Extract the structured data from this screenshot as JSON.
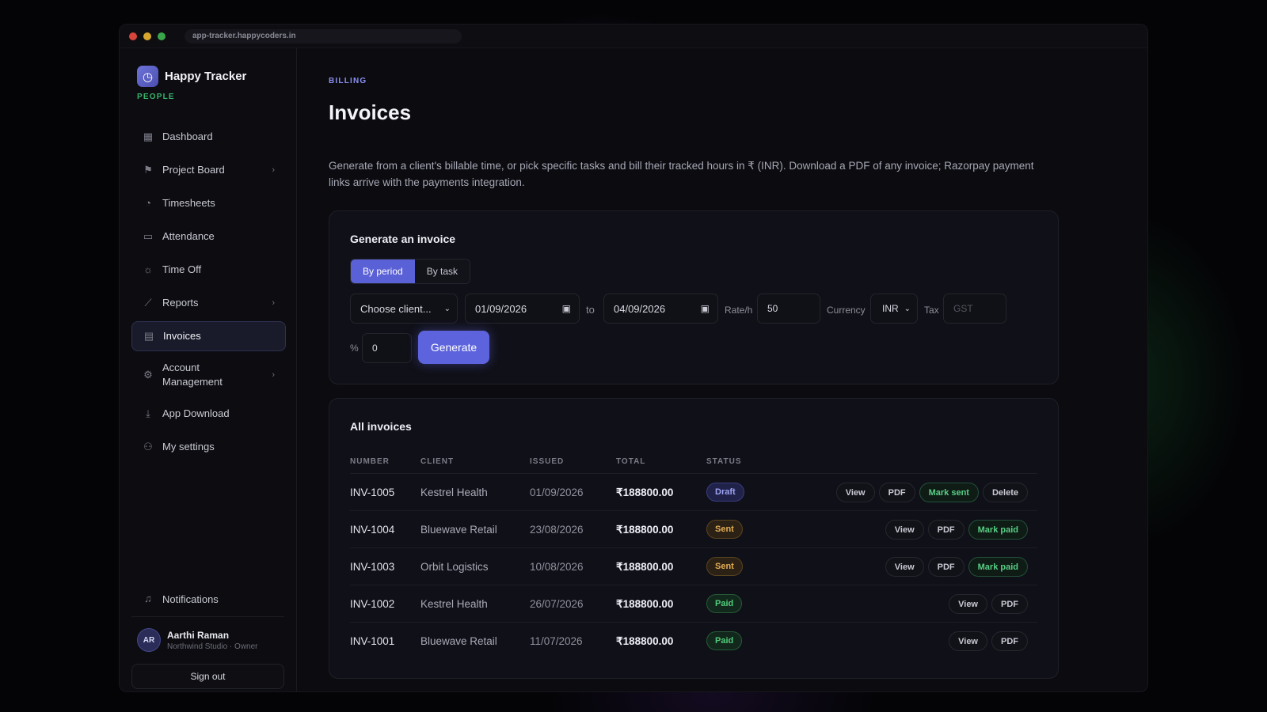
{
  "browser": {
    "url": "app-tracker.happycoders.in"
  },
  "brand": {
    "name": "Happy Tracker",
    "section": "PEOPLE"
  },
  "nav": [
    {
      "label": "Dashboard",
      "icon": "grid-icon"
    },
    {
      "label": "Project Board",
      "icon": "board-icon",
      "chevron": true
    },
    {
      "label": "Timesheets",
      "icon": "clock-icon"
    },
    {
      "label": "Attendance",
      "icon": "calendar-icon"
    },
    {
      "label": "Time Off",
      "icon": "sun-icon"
    },
    {
      "label": "Reports",
      "icon": "chart-icon",
      "chevron": true
    },
    {
      "label": "Invoices",
      "icon": "document-icon",
      "active": true
    },
    {
      "label": "Account Management",
      "icon": "gear-icon",
      "chevron": true
    },
    {
      "label": "App Download",
      "icon": "download-icon"
    },
    {
      "label": "My settings",
      "icon": "user-icon"
    }
  ],
  "notifications": {
    "label": "Notifications"
  },
  "user": {
    "initials": "AR",
    "name": "Aarthi Raman",
    "org": "Northwind Studio · Owner"
  },
  "signout": "Sign out",
  "page": {
    "section": "BILLING",
    "title": "Invoices",
    "description": "Generate from a client's billable time, or pick specific tasks and bill their tracked hours in ₹ (INR). Download a PDF of any invoice; Razorpay payment links arrive with the payments integration."
  },
  "generate": {
    "title": "Generate an invoice",
    "modes": [
      "By period",
      "By task"
    ],
    "active_mode": "By period",
    "client_placeholder": "Choose client...",
    "from_date": "01/09/2026",
    "to_label": "to",
    "to_date": "04/09/2026",
    "rate_label": "Rate/h",
    "rate_value": "50",
    "currency_label": "Currency",
    "currency_value": "INR",
    "tax_label": "Tax",
    "tax_placeholder": "GST",
    "percent_label": "%",
    "percent_value": "0",
    "button": "Generate"
  },
  "invoices": {
    "title": "All invoices",
    "columns": [
      "NUMBER",
      "CLIENT",
      "ISSUED",
      "TOTAL",
      "STATUS"
    ],
    "rows": [
      {
        "number": "INV-1005",
        "client": "Kestrel Health",
        "issued": "01/09/2026",
        "total": "₹188800.00",
        "status": "Draft",
        "actions": [
          "View",
          "PDF",
          "Mark sent",
          "Delete"
        ]
      },
      {
        "number": "INV-1004",
        "client": "Bluewave Retail",
        "issued": "23/08/2026",
        "total": "₹188800.00",
        "status": "Sent",
        "actions": [
          "View",
          "PDF",
          "Mark paid"
        ]
      },
      {
        "number": "INV-1003",
        "client": "Orbit Logistics",
        "issued": "10/08/2026",
        "total": "₹188800.00",
        "status": "Sent",
        "actions": [
          "View",
          "PDF",
          "Mark paid"
        ]
      },
      {
        "number": "INV-1002",
        "client": "Kestrel Health",
        "issued": "26/07/2026",
        "total": "₹188800.00",
        "status": "Paid",
        "actions": [
          "View",
          "PDF"
        ]
      },
      {
        "number": "INV-1001",
        "client": "Bluewave Retail",
        "issued": "11/07/2026",
        "total": "₹188800.00",
        "status": "Paid",
        "actions": [
          "View",
          "PDF"
        ]
      }
    ]
  },
  "colors": {
    "accent": "#5d63dc",
    "brand_green": "#38b36a",
    "draft": "#9ea3f3",
    "sent": "#e3ad56",
    "paid": "#52cb7b"
  }
}
